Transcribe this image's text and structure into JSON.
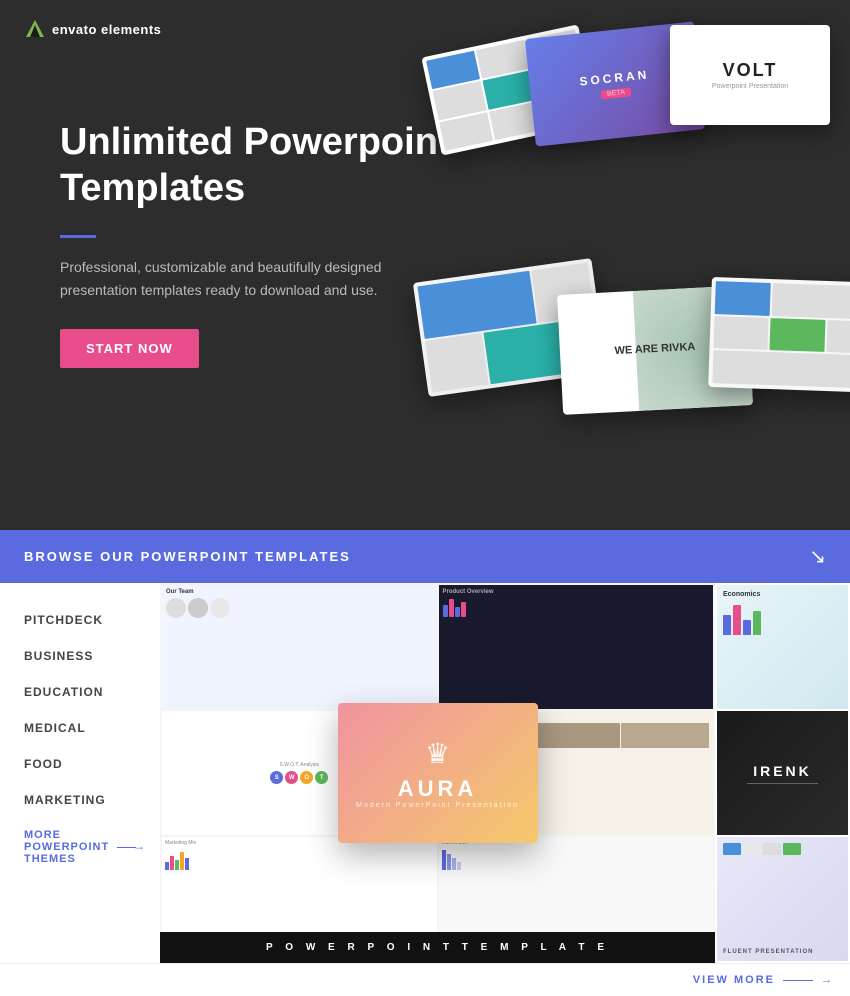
{
  "logo": {
    "brand": "envato",
    "product": "elements"
  },
  "hero": {
    "title": "Unlimited Powerpoint Templates",
    "subtitle": "Professional, customizable and beautifully designed presentation templates ready to download and use.",
    "cta_label": "START NOW",
    "mockups": [
      {
        "name": "VOLT",
        "sub": "Powerpoint Presentation"
      },
      {
        "name": "SOCRAN",
        "sub": "BETA"
      },
      {
        "name": "WE ARE RIVKA",
        "sub": ""
      }
    ]
  },
  "browse": {
    "section_title": "BROWSE OUR POWERPOINT TEMPLATES",
    "categories": [
      {
        "label": "PITCHDECK",
        "active": false
      },
      {
        "label": "BUSINESS",
        "active": false
      },
      {
        "label": "EDUCATION",
        "active": false
      },
      {
        "label": "MEDICAL",
        "active": false
      },
      {
        "label": "FOOD",
        "active": false
      },
      {
        "label": "MARKETING",
        "active": false
      }
    ],
    "more_themes_label": "MORE POWERPOINT THEMES",
    "featured": {
      "name": "AURA",
      "sub": "Modern PowerPoint Presentation"
    },
    "bottom_bar": "P O W E R P O I N T   T E M P L A T E",
    "thumbnails": [
      {
        "label": "Economics",
        "style": "light"
      },
      {
        "label": "IRENK",
        "style": "dark"
      },
      {
        "label": "FLUENT PRESENTATION",
        "style": "light-gray"
      }
    ],
    "view_more_label": "VIEW MORE"
  },
  "colors": {
    "accent_blue": "#5a6be0",
    "accent_pink": "#e84c8b",
    "hero_bg": "#2d2d2d",
    "featured_gradient_start": "#f093a0",
    "featured_gradient_end": "#f5c96a"
  }
}
